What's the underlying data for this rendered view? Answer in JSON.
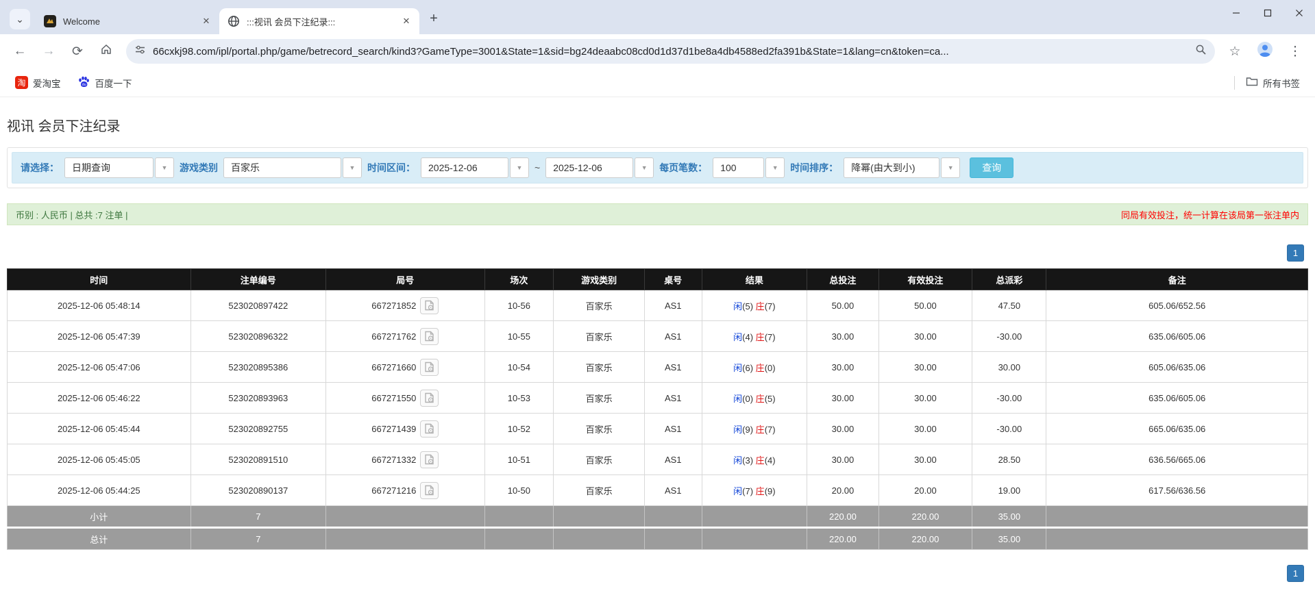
{
  "browser": {
    "tabs": [
      {
        "title": "Welcome"
      },
      {
        "title": ":::视讯 会员下注纪录:::"
      }
    ],
    "url": "66cxkj98.com/ipl/portal.php/game/betrecord_search/kind3?GameType=3001&State=1&sid=bg24deaabc08cd0d1d37d1be8a4db4588ed2fa391b&State=1&lang=cn&token=ca...",
    "bookmarks": [
      {
        "label": "爱淘宝",
        "badge": "淘"
      },
      {
        "label": "百度一下"
      }
    ],
    "bookmarks_all": "所有书签",
    "icons": {
      "tab_chevron": "⌄",
      "tab_close": "✕",
      "new_tab": "+",
      "back": "←",
      "forward": "→",
      "reload": "⟳",
      "star": "☆",
      "menu": "⋮",
      "caret_down": "▼"
    }
  },
  "main": {
    "page_title": "视讯 会员下注纪录",
    "filter": {
      "select_label": "请选择：",
      "select_value": "日期查询",
      "game_label": "游戏类别",
      "game_value": "百家乐",
      "range_label": "时间区间：",
      "date_from": "2025-12-06",
      "range_separator": "~",
      "date_to": "2025-12-06",
      "per_page_label": "每页笔数：",
      "per_page_value": "100",
      "sort_label": "时间排序：",
      "sort_value": "降幂(由大到小)",
      "search_button": "查询"
    },
    "info_bar": {
      "left": "币别 : 人民币 | 总共 :7 注单 |",
      "right": "同局有效投注，统一计算在该局第一张注单内"
    },
    "pagination": {
      "page": "1"
    },
    "table": {
      "headers": [
        "时间",
        "注单编号",
        "局号",
        "场次",
        "游戏类别",
        "桌号",
        "结果",
        "总投注",
        "有效投注",
        "总派彩",
        "备注"
      ],
      "col_widths": [
        "14.1%",
        "10.4%",
        "12.2%",
        "5.3%",
        "7.0%",
        "4.4%",
        "8.1%",
        "5.5%",
        "7.2%",
        "5.7%",
        "20.1%"
      ],
      "rows": [
        {
          "time": "2025-12-06 05:48:14",
          "bet_no": "523020897422",
          "round_no": "667271852",
          "session": "10-56",
          "game": "百家乐",
          "table": "AS1",
          "player_label": "闲",
          "player_value": "(5)",
          "banker_label": "庄",
          "banker_value": "(7)",
          "total_bet": "50.00",
          "valid_bet": "50.00",
          "payout": "47.50",
          "remark": "605.06/652.56"
        },
        {
          "time": "2025-12-06 05:47:39",
          "bet_no": "523020896322",
          "round_no": "667271762",
          "session": "10-55",
          "game": "百家乐",
          "table": "AS1",
          "player_label": "闲",
          "player_value": "(4)",
          "banker_label": "庄",
          "banker_value": "(7)",
          "total_bet": "30.00",
          "valid_bet": "30.00",
          "payout": "-30.00",
          "remark": "635.06/605.06"
        },
        {
          "time": "2025-12-06 05:47:06",
          "bet_no": "523020895386",
          "round_no": "667271660",
          "session": "10-54",
          "game": "百家乐",
          "table": "AS1",
          "player_label": "闲",
          "player_value": "(6)",
          "banker_label": "庄",
          "banker_value": "(0)",
          "total_bet": "30.00",
          "valid_bet": "30.00",
          "payout": "30.00",
          "remark": "605.06/635.06"
        },
        {
          "time": "2025-12-06 05:46:22",
          "bet_no": "523020893963",
          "round_no": "667271550",
          "session": "10-53",
          "game": "百家乐",
          "table": "AS1",
          "player_label": "闲",
          "player_value": "(0)",
          "banker_label": "庄",
          "banker_value": "(5)",
          "total_bet": "30.00",
          "valid_bet": "30.00",
          "payout": "-30.00",
          "remark": "635.06/605.06"
        },
        {
          "time": "2025-12-06 05:45:44",
          "bet_no": "523020892755",
          "round_no": "667271439",
          "session": "10-52",
          "game": "百家乐",
          "table": "AS1",
          "player_label": "闲",
          "player_value": "(9)",
          "banker_label": "庄",
          "banker_value": "(7)",
          "total_bet": "30.00",
          "valid_bet": "30.00",
          "payout": "-30.00",
          "remark": "665.06/635.06"
        },
        {
          "time": "2025-12-06 05:45:05",
          "bet_no": "523020891510",
          "round_no": "667271332",
          "session": "10-51",
          "game": "百家乐",
          "table": "AS1",
          "player_label": "闲",
          "player_value": "(3)",
          "banker_label": "庄",
          "banker_value": "(4)",
          "total_bet": "30.00",
          "valid_bet": "30.00",
          "payout": "28.50",
          "remark": "636.56/665.06"
        },
        {
          "time": "2025-12-06 05:44:25",
          "bet_no": "523020890137",
          "round_no": "667271216",
          "session": "10-50",
          "game": "百家乐",
          "table": "AS1",
          "player_label": "闲",
          "player_value": "(7)",
          "banker_label": "庄",
          "banker_value": "(9)",
          "total_bet": "20.00",
          "valid_bet": "20.00",
          "payout": "19.00",
          "remark": "617.56/636.56"
        }
      ],
      "footers": [
        {
          "label": "小计",
          "count": "7",
          "total_bet": "220.00",
          "valid_bet": "220.00",
          "payout": "35.00"
        },
        {
          "label": "总计",
          "count": "7",
          "total_bet": "220.00",
          "valid_bet": "220.00",
          "payout": "35.00"
        }
      ]
    }
  },
  "colors": {
    "accent_blue": "#337ab7",
    "bet_link_blue": "#337ab7",
    "negative_red": "#ff0000",
    "player_blue": "#1145d8",
    "banker_red": "#e01515",
    "header_bg": "#161616",
    "footer_bg": "#9c9c9c",
    "filter_bg": "#d9edf7",
    "info_bg": "#dff0d8",
    "search_button_bg": "#5bc0de"
  }
}
